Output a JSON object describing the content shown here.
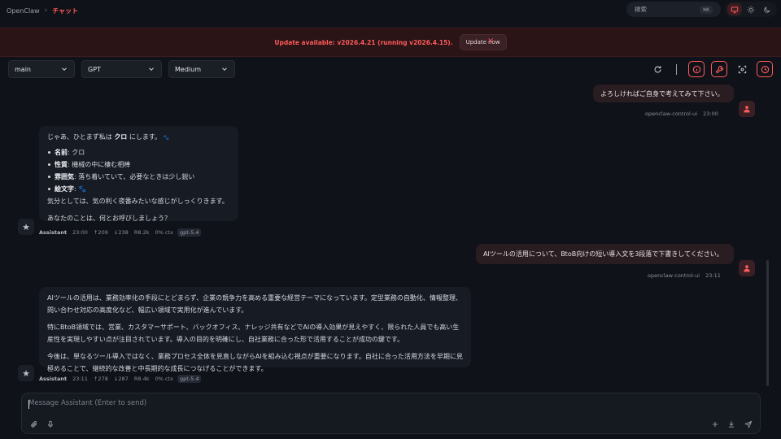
{
  "header": {
    "breadcrumb_root": "OpenClaw",
    "breadcrumb_sep": "›",
    "breadcrumb_current": "チャット",
    "search_label": "検索",
    "search_shortcut": "⌘K",
    "theme_icons": [
      "monitor-icon",
      "sun-icon",
      "moon-icon"
    ],
    "theme_active": "monitor"
  },
  "banner": {
    "text": "Update available: v2026.4.21 (running v2026.4.15).",
    "button": "Update now",
    "close": "×"
  },
  "controls": {
    "session": "main",
    "model": "GPT",
    "effort": "Medium",
    "icons": [
      "refresh-icon",
      "info-icon",
      "wrench-icon",
      "focus-icon",
      "clock-icon"
    ]
  },
  "chat": {
    "msg0_text": "よろしければご自身で考えてみて下さい。",
    "msg0_sender": "openclaw-control-ui",
    "msg0_time": "23:00",
    "msg1_intro_pre": "じゃあ、ひとまず私は ",
    "msg1_intro_name": "クロ",
    "msg1_intro_post": " にします。",
    "msg1_intro_emoji": "🐾",
    "msg1_items": [
      {
        "k": "名前",
        "v": ": クロ"
      },
      {
        "k": "性質",
        "v": ": 機械の中に棲む相棒"
      },
      {
        "k": "雰囲気",
        "v": ": 落ち着いていて、必要なときは少し鋭い"
      },
      {
        "k": "絵文字",
        "v": ": 🐾"
      }
    ],
    "msg1_line2": "気分としては、気の利く夜番みたいな感じがしっくりきます。",
    "msg1_line3": "あなたのことは、何とお呼びしましょう？",
    "msg1_meta": {
      "name": "Assistant",
      "time": "23:00",
      "up": "↑209",
      "down": "↓238",
      "r": "R8.2k",
      "ctx": "0% ctx",
      "model": "gpt-5.4"
    },
    "msg2_text": "AIツールの活用について、BtoB向けの短い導入文を3段落で下書きしてください。",
    "msg2_sender": "openclaw-control-ui",
    "msg2_time": "23:11",
    "msg3_p1": "AIツールの活用は、業務効率化の手段にとどまらず、企業の競争力を高める重要な経営テーマになっています。定型業務の自動化、情報整理、問い合わせ対応の高度化など、幅広い領域で実用化が進んでいます。",
    "msg3_p2": "特にBtoB領域では、営業、カスタマーサポート、バックオフィス、ナレッジ共有などでAIの導入効果が見えやすく、限られた人員でも高い生産性を実現しやすい点が注目されています。導入の目的を明確にし、自社業務に合った形で活用することが成功の鍵です。",
    "msg3_p3": "今後は、単なるツール導入ではなく、業務プロセス全体を見直しながらAIを組み込む視点が重要になります。自社に合った活用方法を早期に見極めることで、継続的な改善と中長期的な成長につなげることができます。",
    "msg3_meta": {
      "name": "Assistant",
      "time": "23:11",
      "up": "↑278",
      "down": "↓287",
      "r": "R8.4k",
      "ctx": "0% ctx",
      "model": "gpt-5.4"
    }
  },
  "composer": {
    "placeholder": "Message Assistant (Enter to send)",
    "icons": [
      "attach-icon",
      "mic-icon",
      "plus-icon",
      "download-icon",
      "send-icon"
    ]
  },
  "colors": {
    "accent": "#ff5a5a",
    "background": "#0f1218",
    "user_bubble": "#2a1d22",
    "assistant_bubble": "#171b23"
  }
}
